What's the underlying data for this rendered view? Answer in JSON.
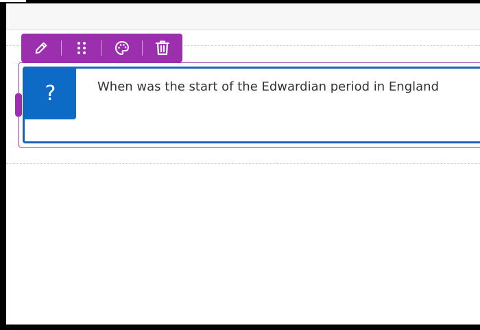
{
  "toolbar": {
    "buttons": [
      {
        "name": "edit",
        "icon": "pencil-icon"
      },
      {
        "name": "drag",
        "icon": "drag-handle-icon"
      },
      {
        "name": "style",
        "icon": "palette-icon"
      },
      {
        "name": "delete",
        "icon": "trash-icon"
      }
    ]
  },
  "question": {
    "badge_label": "?",
    "text": "When was the start of the Edwardian period in England"
  },
  "colors": {
    "accent_purple": "#9b2fae",
    "card_border_blue": "#1a62b8",
    "badge_blue": "#0d6bc6"
  }
}
